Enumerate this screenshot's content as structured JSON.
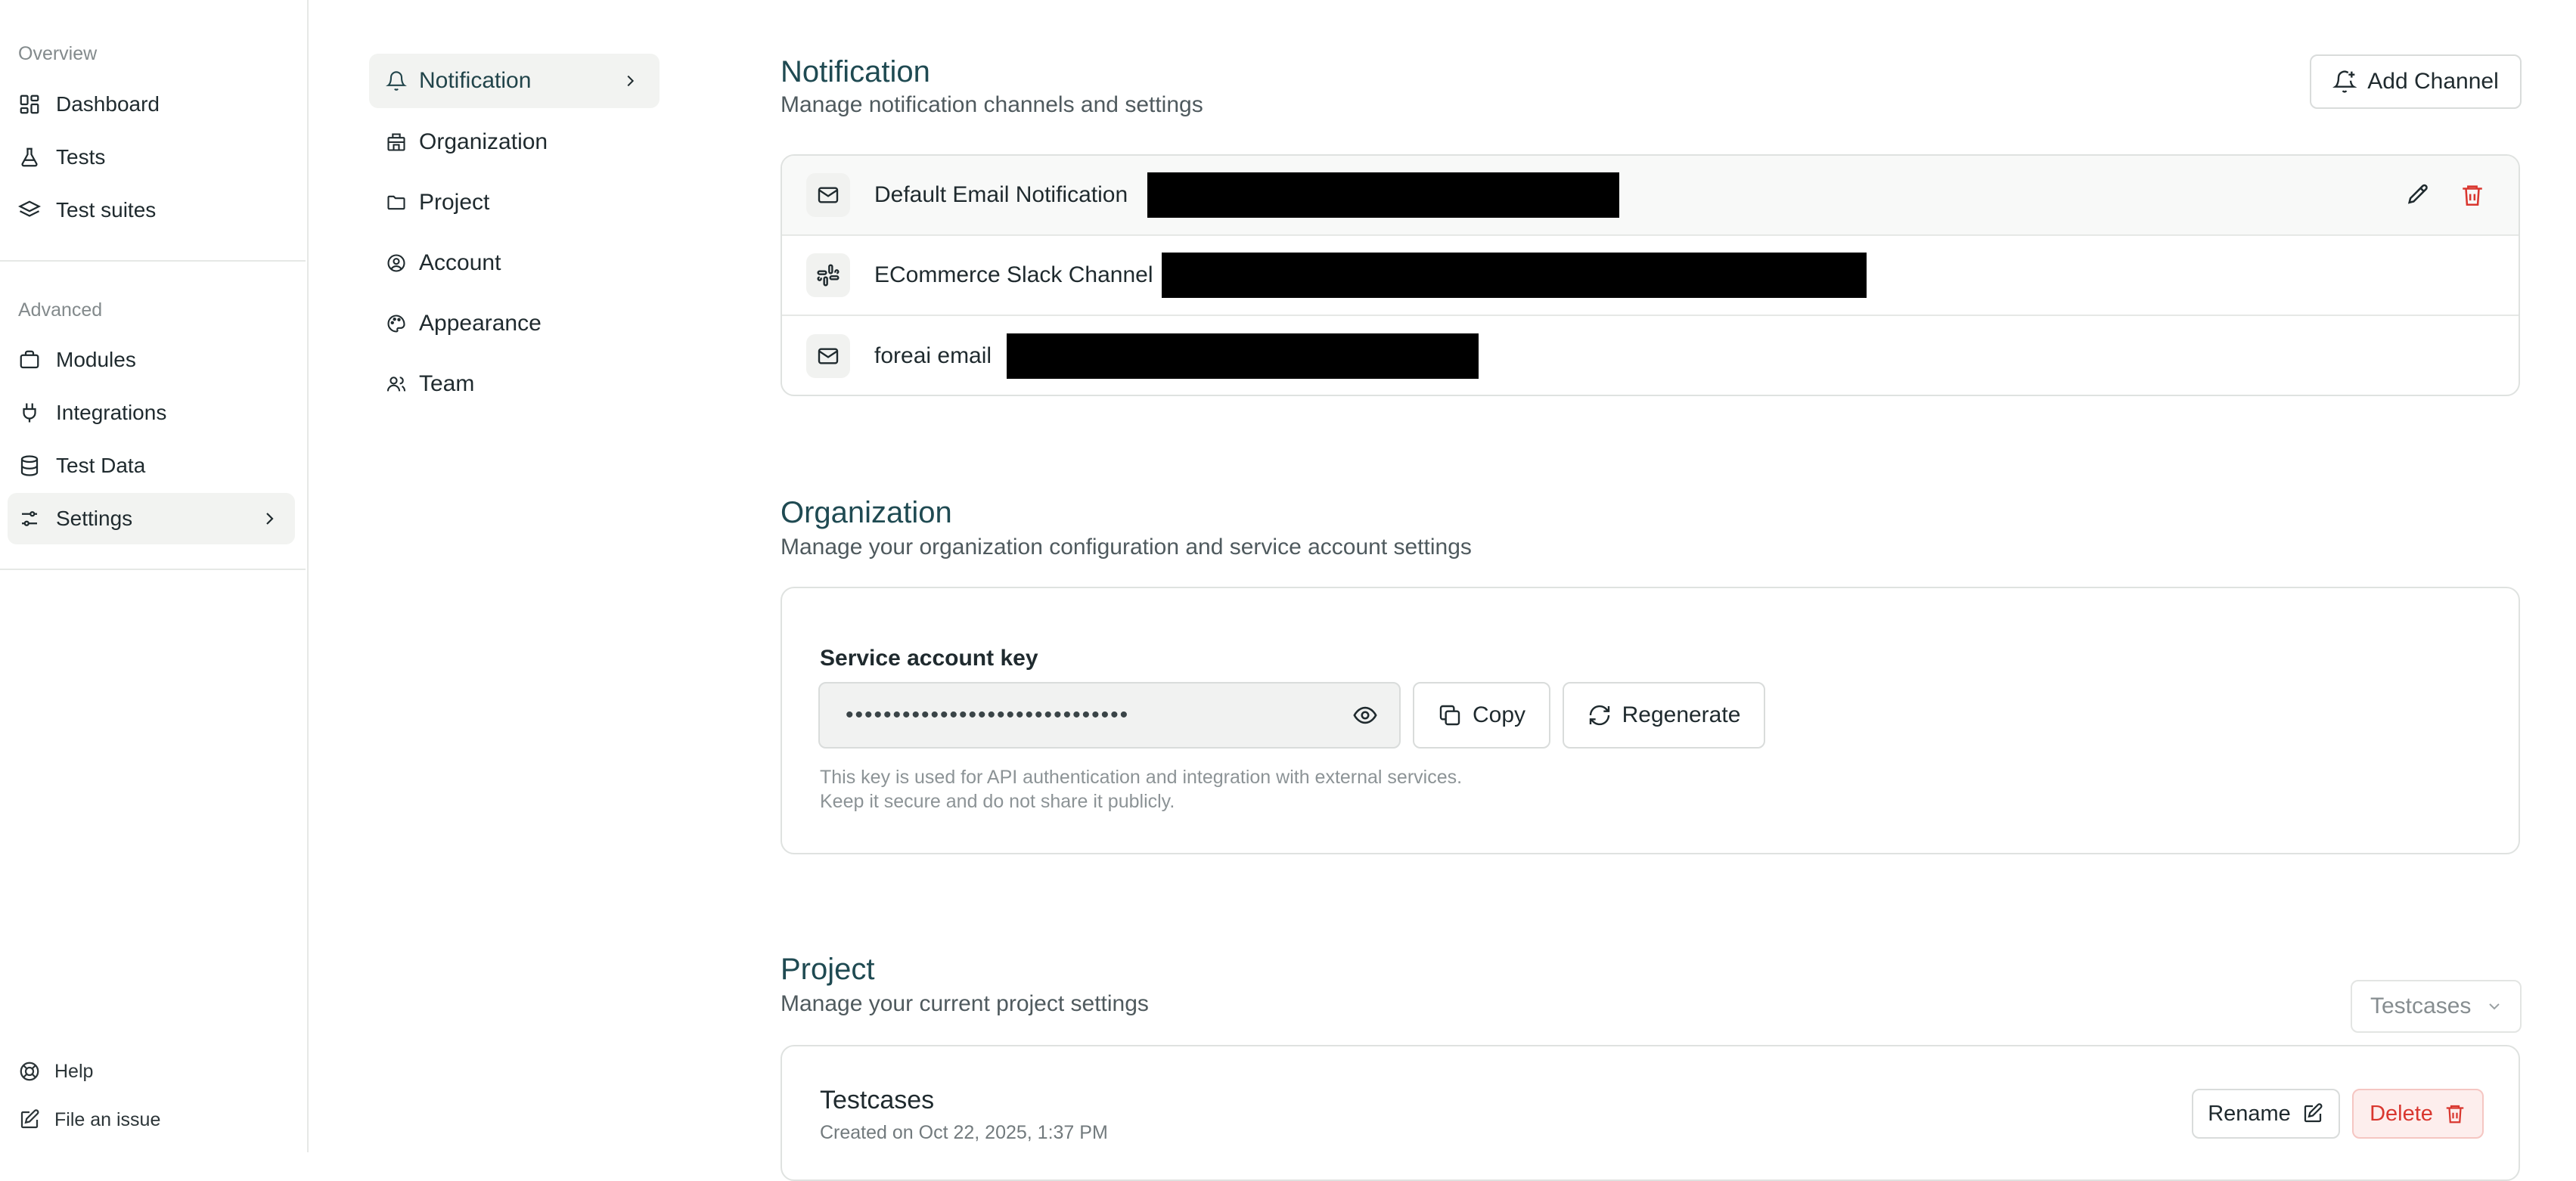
{
  "sidebar": {
    "overview_label": "Overview",
    "overview_items": [
      {
        "label": "Dashboard",
        "icon": "dashboard-icon"
      },
      {
        "label": "Tests",
        "icon": "flask-icon"
      },
      {
        "label": "Test suites",
        "icon": "layers-icon"
      }
    ],
    "advanced_label": "Advanced",
    "advanced_items": [
      {
        "label": "Modules",
        "icon": "briefcase-icon"
      },
      {
        "label": "Integrations",
        "icon": "plug-icon"
      },
      {
        "label": "Test Data",
        "icon": "database-icon"
      },
      {
        "label": "Settings",
        "icon": "settings-sliders-icon",
        "active": true
      }
    ],
    "footer": [
      {
        "label": "Help",
        "icon": "lifebuoy-icon"
      },
      {
        "label": "File an issue",
        "icon": "edit-icon"
      }
    ]
  },
  "settings_nav": {
    "items": [
      {
        "label": "Notification",
        "icon": "bell-icon",
        "active": true
      },
      {
        "label": "Organization",
        "icon": "building-icon"
      },
      {
        "label": "Project",
        "icon": "folder-icon"
      },
      {
        "label": "Account",
        "icon": "user-circle-icon"
      },
      {
        "label": "Appearance",
        "icon": "palette-icon"
      },
      {
        "label": "Team",
        "icon": "users-icon"
      }
    ]
  },
  "notification": {
    "title": "Notification",
    "description": "Manage notification channels and settings",
    "add_button": "Add Channel",
    "channels": [
      {
        "name": "Default Email Notification",
        "icon": "mail-icon"
      },
      {
        "name": "ECommerce Slack Channel",
        "icon": "slack-icon"
      },
      {
        "name": "foreai email",
        "icon": "mail-icon"
      }
    ]
  },
  "organization": {
    "title": "Organization",
    "description": "Manage your organization configuration and service account settings",
    "key_label": "Service account key",
    "key_value": "••••••••••••••••••••••••••••••",
    "copy_button": "Copy",
    "regenerate_button": "Regenerate",
    "hint_line1": "This key is used for API authentication and integration with external services.",
    "hint_line2": "Keep it secure and do not share it publicly."
  },
  "project": {
    "title": "Project",
    "description": "Manage your current project settings",
    "selected": "Testcases",
    "name": "Testcases",
    "created": "Created on Oct 22, 2025, 1:37 PM",
    "rename_button": "Rename",
    "delete_button": "Delete"
  },
  "colors": {
    "accent": "#1f4a52",
    "danger": "#d9372f",
    "danger_bg": "#fdeeed",
    "active_bg": "#f2f3f1"
  }
}
